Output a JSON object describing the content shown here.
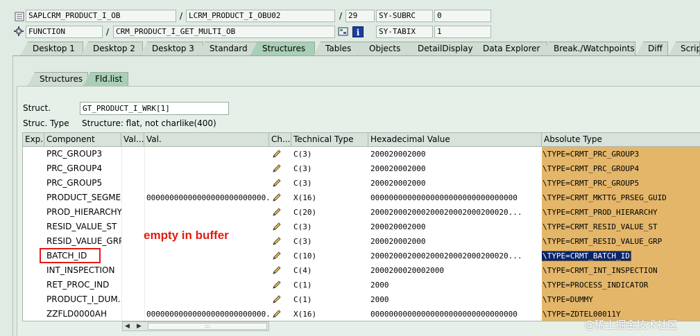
{
  "header": {
    "program": "SAPLCRM_PRODUCT_I_OB",
    "include": "LCRM_PRODUCT_I_OBU02",
    "line": "29",
    "sy_subrc_label": "SY-SUBRC",
    "sy_subrc_value": "0",
    "event_type": "FUNCTION",
    "event_name": "CRM_PRODUCT_I_GET_MULTI_OB",
    "sy_tabix_label": "SY-TABIX",
    "sy_tabix_value": "1",
    "separator": "/"
  },
  "tabs": [
    "Desktop 1",
    "Desktop 2",
    "Desktop 3",
    "Standard",
    "Structures",
    "Tables",
    "Objects",
    "DetailDisplay",
    "Data Explorer",
    "Break./Watchpoints",
    "Diff",
    "Script"
  ],
  "active_tab": "Structures",
  "subtabs": [
    "Structures",
    "Fld.list"
  ],
  "active_subtab": "Fld.list",
  "struct": {
    "label": "Struct.",
    "value": "GT_PRODUCT_I_WRK[1]",
    "type_label": "Struc. Type",
    "type_value": "Structure: flat, not charlike(400)"
  },
  "table": {
    "headers": [
      "Exp.",
      "Component",
      "Val....",
      "Val.",
      "Ch...",
      "Technical Type",
      "Hexadecimal Value",
      "Absolute Type"
    ],
    "rows": [
      {
        "component": "PRC_GROUP3",
        "val": "",
        "tech": "C(3)",
        "hex": "200020002000",
        "abs": "\\TYPE=CRMT_PRC_GROUP3"
      },
      {
        "component": "PRC_GROUP4",
        "val": "",
        "tech": "C(3)",
        "hex": "200020002000",
        "abs": "\\TYPE=CRMT_PRC_GROUP4"
      },
      {
        "component": "PRC_GROUP5",
        "val": "",
        "tech": "C(3)",
        "hex": "200020002000",
        "abs": "\\TYPE=CRMT_PRC_GROUP5"
      },
      {
        "component": "PRODUCT_SEGME...",
        "val": "00000000000000000000000000...",
        "tech": "X(16)",
        "hex": "00000000000000000000000000000000",
        "abs": "\\TYPE=CRMT_MKTTG_PRSEG_GUID"
      },
      {
        "component": "PROD_HIERARCHY",
        "val": "",
        "tech": "C(20)",
        "hex": "200020002000200020002000200020...",
        "abs": "\\TYPE=CRMT_PROD_HIERARCHY"
      },
      {
        "component": "RESID_VALUE_ST",
        "val": "",
        "tech": "C(3)",
        "hex": "200020002000",
        "abs": "\\TYPE=CRMT_RESID_VALUE_ST"
      },
      {
        "component": "RESID_VALUE_GRP",
        "val": "",
        "tech": "C(3)",
        "hex": "200020002000",
        "abs": "\\TYPE=CRMT_RESID_VALUE_GRP"
      },
      {
        "component": "BATCH_ID",
        "val": "",
        "tech": "C(10)",
        "hex": "200020002000200020002000200020...",
        "abs": "\\TYPE=CRMT_BATCH_ID"
      },
      {
        "component": "INT_INSPECTION",
        "val": "",
        "tech": "C(4)",
        "hex": "2000200020002000",
        "abs": "\\TYPE=CRMT_INT_INSPECTION"
      },
      {
        "component": "RET_PROC_IND",
        "val": "",
        "tech": "C(1)",
        "hex": "2000",
        "abs": "\\TYPE=PROCESS_INDICATOR"
      },
      {
        "component": "PRODUCT_I_DUM...",
        "val": "",
        "tech": "C(1)",
        "hex": "2000",
        "abs": "\\TYPE=DUMMY"
      },
      {
        "component": "ZZFLD0000AH",
        "val": "00000000000000000000000000...",
        "tech": "X(16)",
        "hex": "00000000000000000000000000000000",
        "abs": "\\TYPE=ZDTEL00011Y"
      }
    ],
    "selected_row": 7
  },
  "annotation": "empty in buffer",
  "scroll_thumb": ":::",
  "watermark": "@稀土掘金技术社区",
  "icons": {
    "event_icon": "gear-icon",
    "nav_icon": "transfer-icon",
    "info_icon": "info-icon",
    "change_icon": "pencil-icon"
  },
  "colors": {
    "background": "#dfebe3",
    "active_tab": "#a9cfb6",
    "absolute_type_column": "#e3b66a",
    "selection": "#0a246a",
    "annotation": "#e11b0e"
  }
}
